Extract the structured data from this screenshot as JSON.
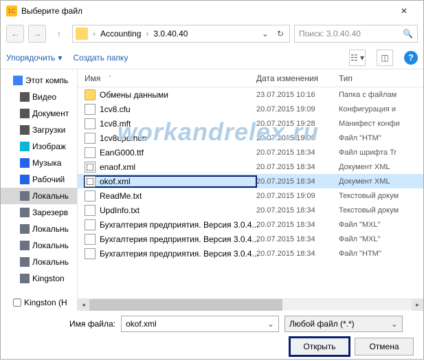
{
  "titlebar": {
    "icon": "1C",
    "title": "Выберите файл"
  },
  "nav": {
    "path_items": [
      "Accounting",
      "3.0.40.40"
    ],
    "search_placeholder": "Поиск: 3.0.40.40"
  },
  "toolbar": {
    "organize": "Упорядочить",
    "new_folder": "Создать папку",
    "help": "?"
  },
  "sidebar": {
    "items": [
      {
        "label": "Этот компь",
        "icon": "pc",
        "sub": false
      },
      {
        "label": "Видео",
        "icon": "video",
        "sub": true
      },
      {
        "label": "Документ",
        "icon": "docs",
        "sub": true
      },
      {
        "label": "Загрузки",
        "icon": "down",
        "sub": true
      },
      {
        "label": "Изображ",
        "icon": "img",
        "sub": true
      },
      {
        "label": "Музыка",
        "icon": "music",
        "sub": true
      },
      {
        "label": "Рабочий",
        "icon": "desk",
        "sub": true
      },
      {
        "label": "Локальнь",
        "icon": "disk",
        "sub": true,
        "selected": true
      },
      {
        "label": "Зарезерв",
        "icon": "disk",
        "sub": true
      },
      {
        "label": "Локальнь",
        "icon": "disk",
        "sub": true
      },
      {
        "label": "Локальнь",
        "icon": "disk",
        "sub": true
      },
      {
        "label": "Локальнь",
        "icon": "disk",
        "sub": true
      },
      {
        "label": "Kingston",
        "icon": "disk",
        "sub": true
      }
    ],
    "footer_item": "Kingston (H"
  },
  "columns": {
    "name": "Имя",
    "date": "Дата изменения",
    "type": "Тип"
  },
  "files": [
    {
      "name": "Обмены данными",
      "date": "23.07.2015 10:16",
      "type": "Папка с файлам",
      "icon": "folder"
    },
    {
      "name": "1cv8.cfu",
      "date": "20.07.2015 19:09",
      "type": "Конфигурация и",
      "icon": "cfg"
    },
    {
      "name": "1cv8.mft",
      "date": "20.07.2015 19:28",
      "type": "Манифест конфи",
      "icon": "cfg"
    },
    {
      "name": "1cv8upd.htm",
      "date": "20.07.2015 19:09",
      "type": "Файл \"HTM\"",
      "icon": "htm"
    },
    {
      "name": "EanG000.ttf",
      "date": "20.07.2015 18:34",
      "type": "Файл шрифта Tr",
      "icon": "ttf"
    },
    {
      "name": "enaof.xml",
      "date": "20.07.2015 18:34",
      "type": "Документ XML",
      "icon": "xml"
    },
    {
      "name": "okof.xml",
      "date": "20.07.2015 18:34",
      "type": "Документ XML",
      "icon": "xml",
      "selected": true
    },
    {
      "name": "ReadMe.txt",
      "date": "20.07.2015 19:09",
      "type": "Текстовый докум",
      "icon": "txt"
    },
    {
      "name": "UpdInfo.txt",
      "date": "20.07.2015 18:34",
      "type": "Текстовый докум",
      "icon": "txt"
    },
    {
      "name": "Бухгалтерия предприятия. Версия 3.0.4...",
      "date": "20.07.2015 18:34",
      "type": "Файл \"MXL\"",
      "icon": "mxl"
    },
    {
      "name": "Бухгалтерия предприятия. Версия 3.0.4...",
      "date": "20.07.2015 18:34",
      "type": "Файл \"MXL\"",
      "icon": "mxl"
    },
    {
      "name": "Бухгалтерия предприятия. Версия 3.0.4...",
      "date": "20.07.2015 18:34",
      "type": "Файл \"HTM\"",
      "icon": "htm"
    }
  ],
  "footer": {
    "filename_label": "Имя файла:",
    "filename_value": "okof.xml",
    "filter": "Любой файл (*.*)",
    "open": "Открыть",
    "cancel": "Отмена"
  },
  "watermark": "workandrelex.ru"
}
